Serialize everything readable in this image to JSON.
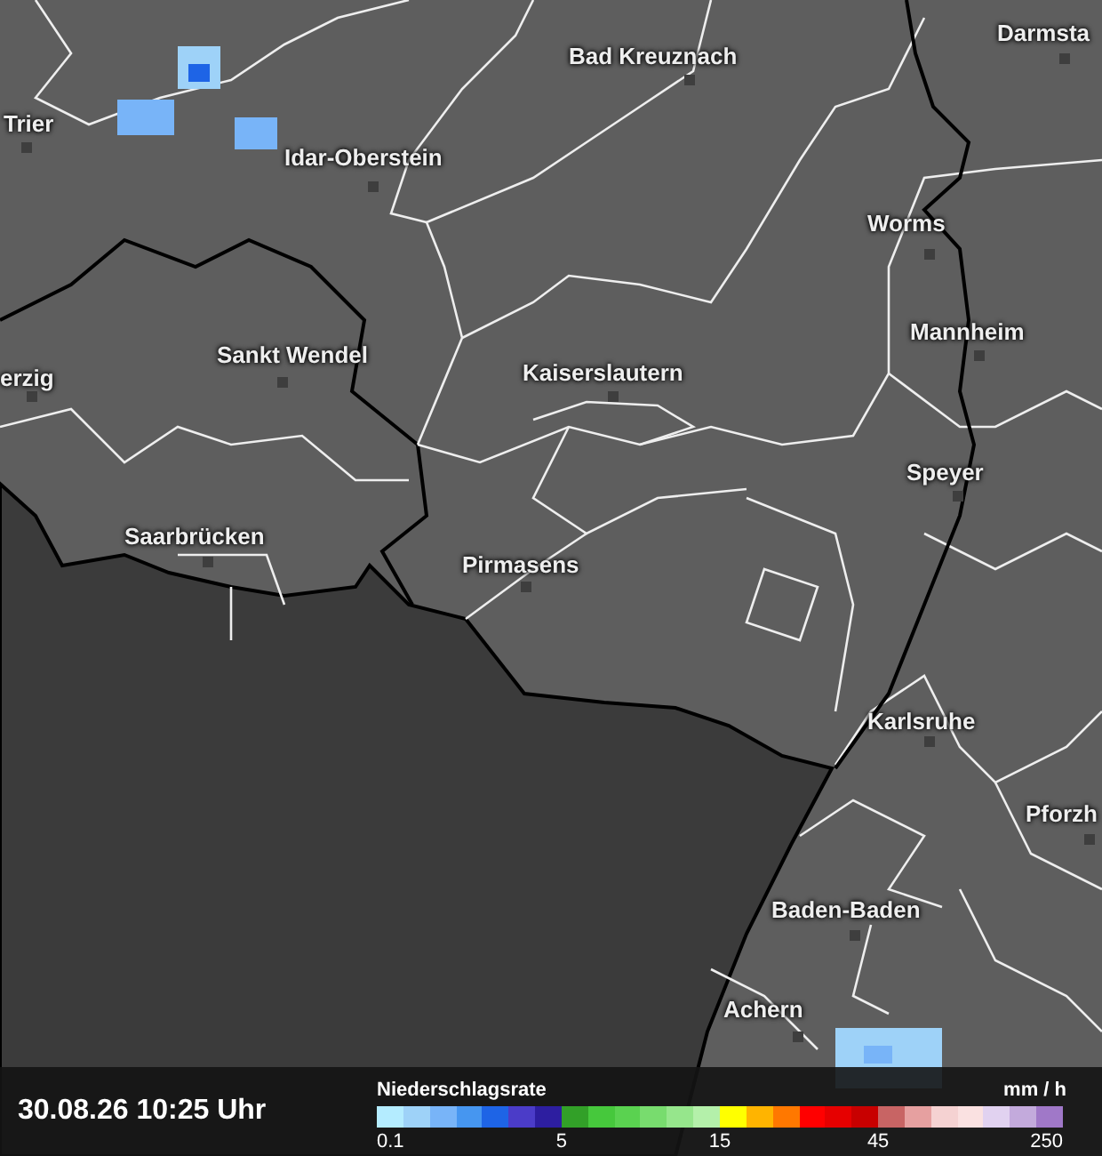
{
  "map": {
    "cities": [
      {
        "name": "Trier"
      },
      {
        "name": "Bad Kreuznach"
      },
      {
        "name": "Darmsta"
      },
      {
        "name": "Idar-Oberstein"
      },
      {
        "name": "Worms"
      },
      {
        "name": "Mannheim"
      },
      {
        "name": "erzig"
      },
      {
        "name": "Sankt Wendel"
      },
      {
        "name": "Kaiserslautern"
      },
      {
        "name": "Speyer"
      },
      {
        "name": "Saarbrücken"
      },
      {
        "name": "Pirmasens"
      },
      {
        "name": "Karlsruhe"
      },
      {
        "name": "Pforzh"
      },
      {
        "name": "Baden-Baden"
      },
      {
        "name": "Achern"
      }
    ]
  },
  "status_bar": {
    "timestamp": "30.08.26 10:25 Uhr"
  },
  "legend": {
    "title": "Niederschlagsrate",
    "unit": "mm / h",
    "swatches": [
      {
        "color": "#b4ecff"
      },
      {
        "color": "#9ed2f8"
      },
      {
        "color": "#78b4f8"
      },
      {
        "color": "#4696f0"
      },
      {
        "color": "#1e64e6"
      },
      {
        "color": "#4b3cc8"
      },
      {
        "color": "#2d1ea0"
      },
      {
        "color": "#32a028"
      },
      {
        "color": "#46c83c"
      },
      {
        "color": "#5ad250"
      },
      {
        "color": "#78dc6e"
      },
      {
        "color": "#96e68c"
      },
      {
        "color": "#b4f0aa"
      },
      {
        "color": "#ffff00"
      },
      {
        "color": "#ffb400"
      },
      {
        "color": "#ff7800"
      },
      {
        "color": "#ff0000"
      },
      {
        "color": "#e60000"
      },
      {
        "color": "#c80000"
      },
      {
        "color": "#c86464"
      },
      {
        "color": "#e6a0a0"
      },
      {
        "color": "#f5d2d2"
      },
      {
        "color": "#fae1e1"
      },
      {
        "color": "#e1d2f0"
      },
      {
        "color": "#c3aadc"
      },
      {
        "color": "#a078c8"
      }
    ],
    "ticks": [
      "0.1",
      "5",
      "15",
      "45",
      "250"
    ]
  }
}
